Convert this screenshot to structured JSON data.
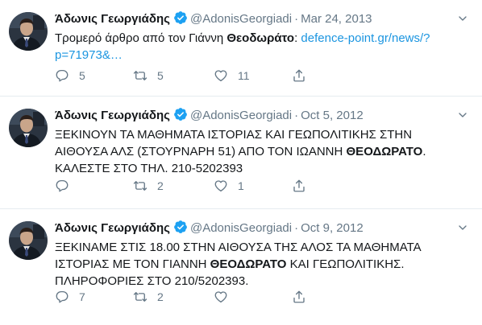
{
  "tweets": [
    {
      "name": "Άδωνις Γεωργιάδης",
      "handle": "@AdonisGeorgiadi",
      "separator": "·",
      "date": "Mar 24, 2013",
      "text_before": "Τρομερό άρθρο από τον Γιάννη ",
      "text_bold": "Θεοδωράτο",
      "text_after": ": ",
      "link": "defence-point.gr/news/?p=71973&…",
      "replies": "5",
      "retweets": "5",
      "likes": "11"
    },
    {
      "name": "Άδωνις Γεωργιάδης",
      "handle": "@AdonisGeorgiadi",
      "separator": "·",
      "date": "Oct 5, 2012",
      "text_before": "ΞΕΚΙΝΟΥΝ ΤΑ ΜΑΘΗΜΑΤΑ ΙΣΤΟΡΙΑΣ ΚΑΙ ΓΕΩΠΟΛΙΤΙΚΗΣ ΣΤΗΝ ΑΙΘΟΥΣΑ ΑΛΣ (ΣΤΟΥΡΝΑΡΗ 51) ΑΠΟ ΤΟΝ ΙΩΑΝΝΗ ",
      "text_bold": "ΘΕΟΔΩΡΑΤΟ",
      "text_after": ". ΚΑΛΕΣΤΕ ΣΤΟ ΤΗΛ. 210-5202393",
      "replies": "",
      "retweets": "2",
      "likes": "1"
    },
    {
      "name": "Άδωνις Γεωργιάδης",
      "handle": "@AdonisGeorgiadi",
      "separator": "·",
      "date": "Oct 9, 2012",
      "text_before": "ΞΕΚΙΝΑΜΕ ΣΤΙΣ 18.00 ΣΤΗΝ ΑΙΘΟΥΣΑ ΤΗΣ ΑΛΟΣ ΤΑ ΜΑΘΗΜΑΤΑ ΙΣΤΟΡΙΑΣ ΜΕ ΤΟΝ ΓΙΑΝΝΗ ",
      "text_bold": "ΘΕΟΔΩΡΑΤΟ",
      "text_after": " ΚΑΙ ΓΕΩΠΟΛΙΤΙΚΗΣ. ΠΛΗΡΟΦΟΡΙΕΣ ΣΤΟ 210/5202393.",
      "replies": "7",
      "retweets": "2",
      "likes": ""
    }
  ],
  "colors": {
    "accent": "#1da1f2",
    "link": "#1b95e0",
    "muted": "#657786",
    "divider": "#e6ecf0"
  },
  "icons": [
    "reply-icon",
    "retweet-icon",
    "like-icon",
    "share-icon",
    "verified-badge-icon",
    "chevron-down-icon"
  ]
}
